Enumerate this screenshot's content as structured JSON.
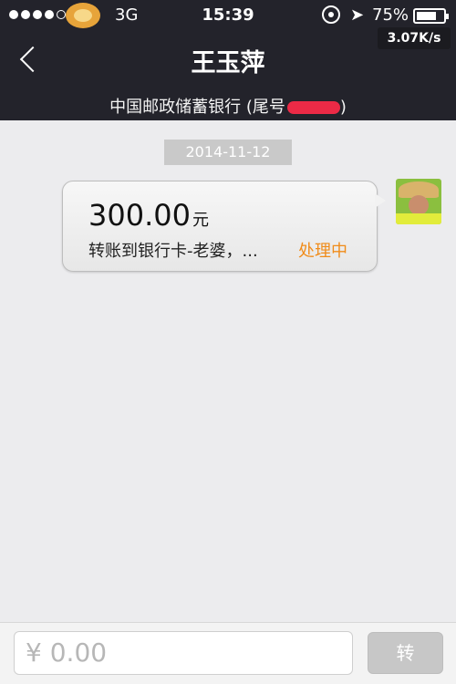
{
  "status_bar": {
    "network": "3G",
    "time": "15:39",
    "battery": "75%",
    "battery_level": 0.75,
    "speed": "3.07K/s"
  },
  "header": {
    "title": "王玉萍",
    "subtitle": "中国邮政储蓄银行 (尾号",
    "subtitle_suffix": ")"
  },
  "chat": {
    "date": "2014-11-12",
    "message": {
      "amount": "300.00",
      "unit": "元",
      "description": "转账到银行卡-老婆，...",
      "status": "处理中",
      "status_color": "#f08c1a"
    }
  },
  "input_bar": {
    "currency": "¥",
    "placeholder": "0.00",
    "send_label": "转"
  }
}
